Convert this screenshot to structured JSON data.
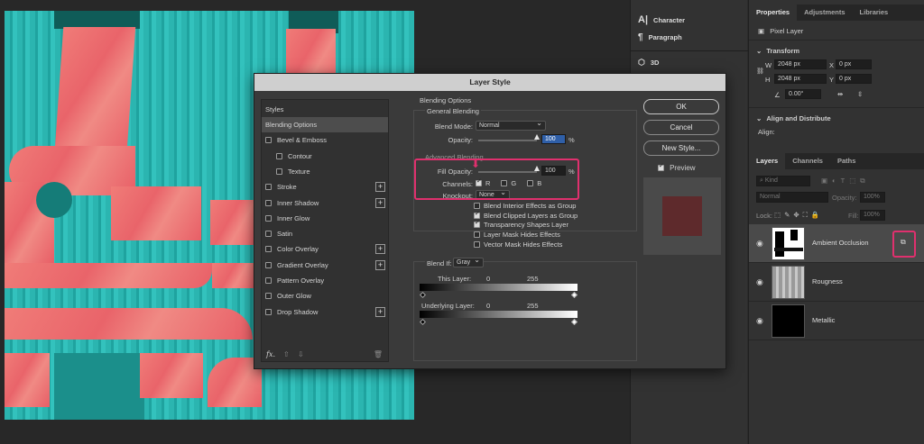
{
  "mid_dock": {
    "items": [
      {
        "icon": "character-icon",
        "label": "Character"
      },
      {
        "icon": "paragraph-icon",
        "label": "Paragraph"
      },
      {
        "icon": "3d-icon",
        "label": "3D"
      }
    ]
  },
  "properties": {
    "tabs": [
      "Properties",
      "Adjustments",
      "Libraries"
    ],
    "layer_type": "Pixel Layer",
    "transform_label": "Transform",
    "w_label": "W",
    "w_value": "2048 px",
    "h_label": "H",
    "h_value": "2048 px",
    "x_label": "X",
    "x_value": "0 px",
    "y_label": "Y",
    "y_value": "0 px",
    "angle_value": "0.00°",
    "align_label": "Align and Distribute",
    "align_sub": "Align:"
  },
  "layers": {
    "tabs": [
      "Layers",
      "Channels",
      "Paths"
    ],
    "kind_placeholder": "Kind",
    "blend_mode": "Normal",
    "opacity_label": "Opacity:",
    "opacity_value": "100%",
    "lock_label": "Lock:",
    "fill_label": "Fill:",
    "fill_value": "100%",
    "items": [
      {
        "name": "Ambient Occlusion",
        "selected": true
      },
      {
        "name": "Rougness",
        "selected": false
      },
      {
        "name": "Metallic",
        "selected": false
      }
    ]
  },
  "dialog": {
    "title": "Layer Style",
    "styles_header": "Styles",
    "styles": [
      {
        "label": "Blending Options",
        "checkbox": false,
        "plus": false,
        "selected": true,
        "indent": false
      },
      {
        "label": "Bevel & Emboss",
        "checkbox": true,
        "plus": false,
        "selected": false,
        "indent": false
      },
      {
        "label": "Contour",
        "checkbox": true,
        "plus": false,
        "selected": false,
        "indent": true
      },
      {
        "label": "Texture",
        "checkbox": true,
        "plus": false,
        "selected": false,
        "indent": true
      },
      {
        "label": "Stroke",
        "checkbox": true,
        "plus": true,
        "selected": false,
        "indent": false
      },
      {
        "label": "Inner Shadow",
        "checkbox": true,
        "plus": true,
        "selected": false,
        "indent": false
      },
      {
        "label": "Inner Glow",
        "checkbox": true,
        "plus": false,
        "selected": false,
        "indent": false
      },
      {
        "label": "Satin",
        "checkbox": true,
        "plus": false,
        "selected": false,
        "indent": false
      },
      {
        "label": "Color Overlay",
        "checkbox": true,
        "plus": true,
        "selected": false,
        "indent": false
      },
      {
        "label": "Gradient Overlay",
        "checkbox": true,
        "plus": true,
        "selected": false,
        "indent": false
      },
      {
        "label": "Pattern Overlay",
        "checkbox": true,
        "plus": false,
        "selected": false,
        "indent": false
      },
      {
        "label": "Outer Glow",
        "checkbox": true,
        "plus": false,
        "selected": false,
        "indent": false
      },
      {
        "label": "Drop Shadow",
        "checkbox": true,
        "plus": true,
        "selected": false,
        "indent": false
      }
    ],
    "fx_label": "fx.",
    "blending_options": "Blending Options",
    "general_blending": "General Blending",
    "blend_mode_label": "Blend Mode:",
    "blend_mode_value": "Normal",
    "opacity_label": "Opacity:",
    "opacity_value": "100",
    "opacity_level": 1.0,
    "percent": "%",
    "advanced_blending": "Advanced Blending",
    "fill_opacity_label": "Fill Opacity:",
    "fill_opacity_value": "100",
    "fill_opacity_level": 1.0,
    "channels_label": "Channels:",
    "channels": [
      {
        "label": "R",
        "checked": true
      },
      {
        "label": "G",
        "checked": false
      },
      {
        "label": "B",
        "checked": false
      }
    ],
    "knockout_label": "Knockout:",
    "knockout_value": "None",
    "options": [
      {
        "label": "Blend Interior Effects as Group",
        "checked": false
      },
      {
        "label": "Blend Clipped Layers as Group",
        "checked": true
      },
      {
        "label": "Transparency Shapes Layer",
        "checked": true
      },
      {
        "label": "Layer Mask Hides Effects",
        "checked": false
      },
      {
        "label": "Vector Mask Hides Effects",
        "checked": false
      }
    ],
    "blend_if_label": "Blend If:",
    "blend_if_value": "Gray",
    "this_layer_label": "This Layer:",
    "this_layer_min": "0",
    "this_layer_max": "255",
    "underlying_label": "Underlying Layer:",
    "underlying_min": "0",
    "underlying_max": "255",
    "buttons": {
      "ok": "OK",
      "cancel": "Cancel",
      "new_style": "New Style..."
    },
    "preview_label": "Preview",
    "preview_checked": true
  },
  "colors": {
    "highlight": "#e0306e",
    "teal": "#2bb5b0",
    "pink": "#ec6e72"
  }
}
